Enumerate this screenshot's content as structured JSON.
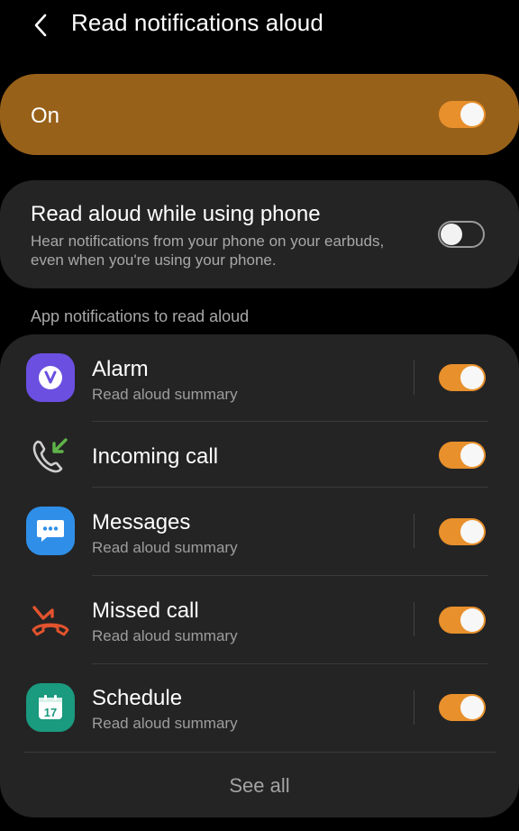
{
  "header": {
    "title": "Read notifications aloud"
  },
  "master": {
    "label": "On",
    "enabled": true
  },
  "phone_setting": {
    "title": "Read aloud while using phone",
    "description": "Hear notifications from your phone on your earbuds, even when you're using your phone.",
    "enabled": false
  },
  "section": {
    "label": "App notifications to read aloud"
  },
  "apps": [
    {
      "name": "Alarm",
      "subtitle": "Read aloud summary",
      "enabled": true,
      "icon": "alarm-icon"
    },
    {
      "name": "Incoming call",
      "subtitle": "",
      "enabled": true,
      "icon": "incoming-call-icon"
    },
    {
      "name": "Messages",
      "subtitle": "Read aloud summary",
      "enabled": true,
      "icon": "messages-icon"
    },
    {
      "name": "Missed call",
      "subtitle": "Read aloud summary",
      "enabled": true,
      "icon": "missed-call-icon"
    },
    {
      "name": "Schedule",
      "subtitle": "Read aloud summary",
      "enabled": true,
      "icon": "calendar-icon",
      "icon_text": "17"
    }
  ],
  "footer": {
    "see_all": "See all"
  },
  "colors": {
    "accent": "#e8902c",
    "master_bg": "#98611a",
    "card_bg": "#242424",
    "alarm": "#6b4fe0",
    "messages": "#2f8fe8",
    "missed_call": "#e2532e",
    "incoming_arrow": "#5fb34a",
    "schedule": "#1a9a7e"
  }
}
